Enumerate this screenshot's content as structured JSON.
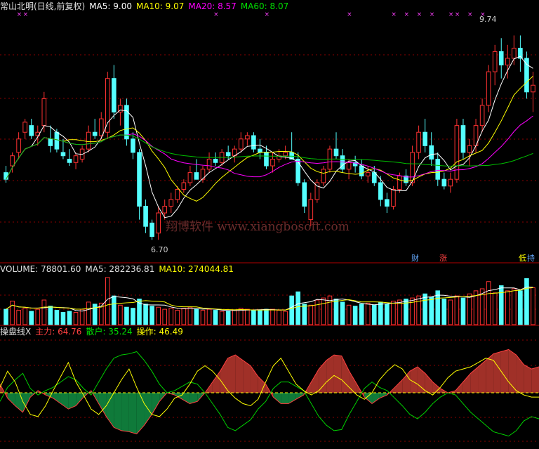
{
  "price_panel": {
    "stock_name": "常山北明(日线,前复权)",
    "ma5": "MA5: 9.00",
    "ma10": "MA10: 9.07",
    "ma20": "MA20: 8.57",
    "ma60": "MA60: 8.07",
    "high_label": "9.74",
    "low_label": "6.70",
    "markers": [
      "财",
      "涨",
      "低",
      "持"
    ],
    "watermark": "翔博软件 www.xiangbosoft.com"
  },
  "volume_panel": {
    "volume": "VOLUME: 78801.60",
    "ma5": "MA5: 282236.81",
    "ma10": "MA10: 274044.81"
  },
  "indicator_panel": {
    "name": "操盘线X",
    "main": "主力: 64.76",
    "retail": "散户: 35.24",
    "operation": "操作: 46.49"
  },
  "colors": {
    "up": "#ff3232",
    "down": "#54ffff",
    "ma5": "#ffffff",
    "ma10": "#ffff00",
    "ma20": "#ff00ff",
    "ma60": "#00c000",
    "grid": "#8b0000",
    "fill_pos": "#a03028",
    "fill_neg": "#0f7a3a"
  },
  "chart_data": {
    "type": "candlestick",
    "ylim": [
      6.4,
      10.1
    ],
    "candles": [
      [
        7.7,
        7.8,
        7.55,
        7.6
      ],
      [
        7.8,
        8.0,
        7.7,
        7.95
      ],
      [
        8.0,
        8.3,
        7.9,
        8.2
      ],
      [
        8.3,
        8.5,
        8.2,
        8.45
      ],
      [
        8.4,
        8.5,
        8.2,
        8.25
      ],
      [
        8.25,
        8.4,
        8.1,
        8.3
      ],
      [
        8.4,
        8.9,
        8.3,
        8.8
      ],
      [
        8.2,
        8.4,
        8.0,
        8.1
      ],
      [
        8.3,
        8.35,
        8.0,
        8.05
      ],
      [
        8.0,
        8.2,
        7.9,
        7.95
      ],
      [
        7.9,
        8.05,
        7.8,
        7.85
      ],
      [
        7.85,
        8.0,
        7.75,
        7.95
      ],
      [
        7.9,
        8.1,
        7.85,
        8.05
      ],
      [
        8.05,
        8.4,
        8.0,
        8.3
      ],
      [
        8.3,
        8.5,
        8.2,
        8.25
      ],
      [
        8.25,
        8.6,
        8.2,
        8.5
      ],
      [
        8.3,
        9.2,
        8.2,
        9.1
      ],
      [
        9.1,
        9.3,
        8.5,
        8.6
      ],
      [
        8.6,
        8.8,
        8.4,
        8.7
      ],
      [
        8.7,
        8.8,
        8.1,
        8.2
      ],
      [
        8.2,
        8.3,
        7.9,
        8.0
      ],
      [
        8.0,
        8.05,
        7.0,
        7.2
      ],
      [
        7.2,
        7.3,
        6.8,
        6.9
      ],
      [
        6.95,
        7.0,
        6.7,
        6.75
      ],
      [
        6.8,
        7.2,
        6.7,
        7.1
      ],
      [
        7.1,
        7.3,
        7.0,
        7.2
      ],
      [
        7.2,
        7.4,
        7.1,
        7.3
      ],
      [
        7.3,
        7.5,
        7.25,
        7.45
      ],
      [
        7.45,
        7.6,
        7.4,
        7.55
      ],
      [
        7.55,
        7.8,
        7.5,
        7.7
      ],
      [
        7.7,
        7.9,
        7.6,
        7.6
      ],
      [
        7.6,
        7.8,
        7.55,
        7.75
      ],
      [
        7.75,
        8.0,
        7.7,
        7.9
      ],
      [
        7.9,
        8.0,
        7.8,
        7.85
      ],
      [
        7.85,
        8.05,
        7.8,
        8.0
      ],
      [
        8.0,
        8.1,
        7.9,
        7.95
      ],
      [
        7.95,
        8.1,
        7.85,
        8.05
      ],
      [
        8.05,
        8.3,
        8.0,
        8.2
      ],
      [
        8.2,
        8.3,
        8.1,
        8.25
      ],
      [
        8.25,
        8.3,
        8.0,
        8.05
      ],
      [
        8.05,
        8.2,
        7.9,
        8.0
      ],
      [
        8.0,
        8.1,
        7.75,
        7.8
      ],
      [
        7.8,
        8.0,
        7.7,
        7.9
      ],
      [
        7.9,
        8.05,
        7.85,
        7.95
      ],
      [
        7.95,
        8.1,
        7.9,
        8.0
      ],
      [
        8.0,
        8.3,
        7.95,
        7.9
      ],
      [
        7.9,
        8.0,
        7.5,
        7.55
      ],
      [
        7.55,
        7.6,
        7.1,
        7.2
      ],
      [
        7.0,
        7.4,
        6.9,
        7.3
      ],
      [
        7.3,
        7.6,
        7.25,
        7.55
      ],
      [
        7.55,
        7.8,
        7.5,
        7.75
      ],
      [
        7.75,
        8.1,
        7.7,
        8.05
      ],
      [
        8.05,
        8.3,
        7.9,
        7.95
      ],
      [
        7.95,
        8.05,
        7.7,
        7.75
      ],
      [
        7.75,
        7.9,
        7.6,
        7.85
      ],
      [
        7.85,
        7.95,
        7.7,
        7.8
      ],
      [
        7.8,
        7.9,
        7.6,
        7.65
      ],
      [
        7.65,
        7.8,
        7.55,
        7.7
      ],
      [
        7.7,
        7.8,
        7.5,
        7.55
      ],
      [
        7.55,
        7.65,
        7.2,
        7.3
      ],
      [
        7.3,
        7.4,
        7.1,
        7.2
      ],
      [
        7.2,
        7.5,
        7.15,
        7.45
      ],
      [
        7.45,
        7.7,
        7.4,
        7.65
      ],
      [
        7.65,
        7.75,
        7.5,
        7.55
      ],
      [
        7.55,
        8.1,
        7.5,
        8.0
      ],
      [
        8.0,
        8.4,
        7.9,
        8.3
      ],
      [
        8.3,
        8.5,
        8.0,
        8.1
      ],
      [
        8.1,
        8.3,
        7.8,
        7.9
      ],
      [
        7.9,
        8.0,
        7.5,
        7.6
      ],
      [
        7.6,
        7.7,
        7.45,
        7.5
      ],
      [
        7.5,
        7.7,
        7.4,
        7.6
      ],
      [
        7.6,
        8.5,
        7.55,
        8.4
      ],
      [
        8.4,
        8.5,
        7.9,
        8.0
      ],
      [
        8.0,
        8.2,
        7.8,
        8.1
      ],
      [
        8.1,
        8.5,
        8.0,
        8.4
      ],
      [
        8.4,
        8.8,
        8.3,
        8.7
      ],
      [
        8.7,
        9.3,
        8.6,
        9.2
      ],
      [
        9.2,
        9.6,
        9.0,
        9.5
      ],
      [
        9.5,
        9.7,
        9.1,
        9.3
      ],
      [
        9.3,
        9.6,
        9.1,
        9.4
      ],
      [
        9.4,
        9.74,
        9.3,
        9.55
      ],
      [
        9.55,
        9.74,
        9.2,
        9.4
      ],
      [
        9.4,
        9.5,
        8.8,
        8.9
      ],
      [
        8.9,
        9.2,
        8.6,
        9.0
      ]
    ],
    "volume_ylim": [
      0,
      480000
    ],
    "volume": [
      150,
      230,
      140,
      160,
      130,
      150,
      240,
      180,
      140,
      120,
      130,
      120,
      150,
      220,
      200,
      210,
      460,
      280,
      190,
      170,
      160,
      250,
      200,
      180,
      170,
      150,
      160,
      140,
      160,
      170,
      150,
      140,
      150,
      140,
      130,
      130,
      140,
      160,
      150,
      140,
      140,
      150,
      150,
      140,
      130,
      280,
      320,
      200,
      190,
      240,
      260,
      280,
      250,
      220,
      190,
      180,
      200,
      210,
      190,
      220,
      200,
      230,
      240,
      250,
      260,
      280,
      300,
      270,
      330,
      250,
      240,
      280,
      260,
      300,
      330,
      350,
      420,
      310,
      380,
      330,
      350,
      330,
      450,
      360
    ],
    "indicator_ylim": [
      0,
      100
    ],
    "main_force": [
      58,
      45,
      38,
      32,
      46,
      52,
      48,
      45,
      40,
      35,
      38,
      46,
      52,
      40,
      28,
      18,
      15,
      14,
      12,
      20,
      30,
      42,
      50,
      48,
      44,
      40,
      42,
      50,
      60,
      70,
      82,
      85,
      80,
      75,
      65,
      58,
      46,
      40,
      40,
      44,
      48,
      60,
      72,
      80,
      85,
      84,
      70,
      58,
      46,
      40,
      45,
      48,
      55,
      62,
      70,
      74,
      68,
      60,
      54,
      50,
      52,
      60,
      68,
      74,
      80,
      86,
      88,
      90,
      85,
      76,
      72,
      74
    ],
    "operation": [
      55,
      70,
      60,
      42,
      30,
      28,
      38,
      52,
      65,
      78,
      60,
      48,
      35,
      30,
      38,
      50,
      62,
      72,
      55,
      40,
      30,
      28,
      35,
      45,
      48,
      58,
      70,
      75,
      70,
      62,
      52,
      45,
      40,
      38,
      44,
      60,
      75,
      82,
      70,
      58,
      52,
      48,
      52,
      60,
      66,
      62,
      55,
      48,
      44,
      50,
      62,
      70,
      76,
      72,
      62,
      58,
      52,
      48,
      55,
      64,
      70,
      72,
      74,
      78,
      82,
      80,
      70,
      60,
      52,
      48,
      46,
      46
    ]
  }
}
